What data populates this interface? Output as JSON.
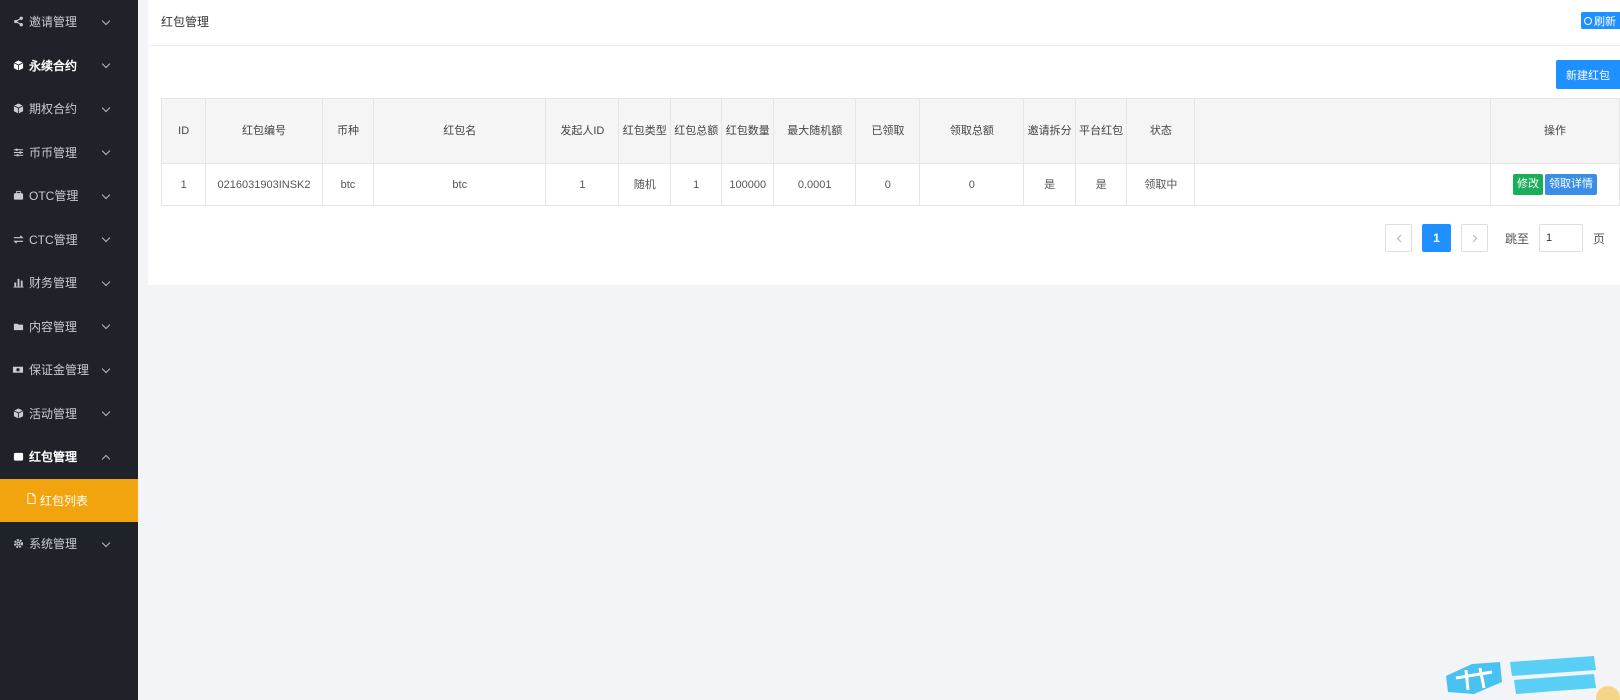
{
  "sidebar": {
    "items": [
      {
        "label": "邀请管理",
        "icon": "share-icon"
      },
      {
        "label": "永续合约",
        "icon": "cube-icon"
      },
      {
        "label": "期权合约",
        "icon": "cube-icon"
      },
      {
        "label": "币币管理",
        "icon": "sliders-icon"
      },
      {
        "label": "OTC管理",
        "icon": "briefcase-icon"
      },
      {
        "label": "CTC管理",
        "icon": "exchange-icon"
      },
      {
        "label": "财务管理",
        "icon": "bar-chart-icon"
      },
      {
        "label": "内容管理",
        "icon": "folder-icon"
      },
      {
        "label": "保证金管理",
        "icon": "money-icon"
      },
      {
        "label": "活动管理",
        "icon": "cube-icon"
      },
      {
        "label": "红包管理",
        "icon": "wallet-icon"
      },
      {
        "label": "红包列表",
        "icon": "file-icon"
      },
      {
        "label": "系统管理",
        "icon": "gear-icon"
      }
    ]
  },
  "page": {
    "title": "红包管理",
    "refresh_label": "刷新",
    "new_label": "新建红包"
  },
  "table": {
    "headers": [
      "ID",
      "红包编号",
      "币种",
      "红包名",
      "发起人ID",
      "红包类型",
      "红包总额",
      "红包数量",
      "最大随机额",
      "已领取",
      "领取总额",
      "邀请拆分",
      "平台红包",
      "状态",
      "操作"
    ],
    "rows": [
      {
        "id": "1",
        "code": "0216031903INSK2",
        "coin": "btc",
        "name": "btc",
        "creator_id": "1",
        "type": "随机",
        "total": "1",
        "count": "100000",
        "max_random": "0.0001",
        "claimed": "0",
        "claimed_total": "0",
        "invite_split": "是",
        "platform": "是",
        "status": "领取中",
        "edit_label": "修改",
        "detail_label": "领取详情"
      }
    ]
  },
  "pager": {
    "current": "1",
    "jump_label": "跳至",
    "jump_value": "1",
    "page_suffix": "页"
  },
  "colors": {
    "sidebar_bg": "#20222a",
    "active_sub": "#f2a40f",
    "primary": "#1e90ff",
    "success": "#1aae5a",
    "danger": "#e33333"
  }
}
